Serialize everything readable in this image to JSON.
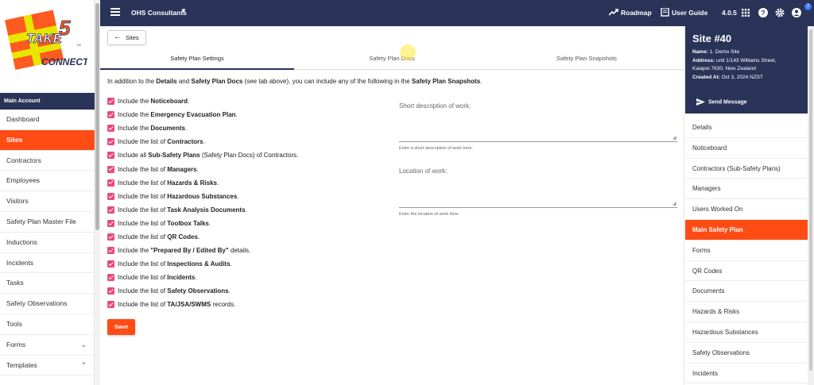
{
  "logo": {
    "line1": "TAKE",
    "num": "5",
    "line2": "CONNECT",
    "tm": "TM"
  },
  "sidebar": {
    "section": "Main Account",
    "items": [
      {
        "label": "Dashboard"
      },
      {
        "label": "Sites",
        "active": true
      },
      {
        "label": "Contractors"
      },
      {
        "label": "Employees"
      },
      {
        "label": "Visitors"
      },
      {
        "label": "Safety Plan Master File"
      },
      {
        "label": "Inductions"
      },
      {
        "label": "Incidents"
      },
      {
        "label": "Tasks"
      },
      {
        "label": "Safety Observations"
      },
      {
        "label": "Tools"
      },
      {
        "label": "Forms",
        "chevron": "⌄"
      },
      {
        "label": "Templates",
        "chevron": "⌃"
      }
    ]
  },
  "topbar": {
    "org": "OHS Consultants",
    "roadmap": "Roadmap",
    "user_guide": "User Guide",
    "version": "4.0.5",
    "notif_count": "2"
  },
  "content": {
    "back_label": "Sites",
    "tabs": [
      "Safety Plan Settings",
      "Safety Plan Docs",
      "Safety Plan Snapshots"
    ],
    "intro": {
      "p1": "In addition to the ",
      "b1": "Details",
      "p2": " and ",
      "b2": "Safety Plan Docs",
      "p3": " (see tab above), you can include any of the following in the ",
      "b3": "Safety Plan Snapshots",
      "p4": "."
    },
    "checks": [
      {
        "pre": "Include the ",
        "bold": "Noticeboard",
        "post": "."
      },
      {
        "pre": "Include the ",
        "bold": "Emergency Evacuation Plan",
        "post": "."
      },
      {
        "pre": "Include the ",
        "bold": "Documents",
        "post": "."
      },
      {
        "pre": "Include the list of ",
        "bold": "Contractors",
        "post": "."
      },
      {
        "pre": "Include all ",
        "bold": "Sub-Safety Plans",
        "post": " (Safety Plan Docs) of Contractors."
      },
      {
        "pre": "Include the list of ",
        "bold": "Managers",
        "post": "."
      },
      {
        "pre": "Include the list of ",
        "bold": "Hazards & Risks",
        "post": "."
      },
      {
        "pre": "Include the list of ",
        "bold": "Hazardous Substances",
        "post": "."
      },
      {
        "pre": "Include the list of ",
        "bold": "Task Analysis Documents",
        "post": "."
      },
      {
        "pre": "Include the list of ",
        "bold": "Toolbox Talks",
        "post": "."
      },
      {
        "pre": "Include the list of ",
        "bold": "QR Codes",
        "post": "."
      },
      {
        "pre": "Include the ",
        "bold": "\"Prepared By / Edited By\"",
        "post": " details."
      },
      {
        "pre": "Include the list of ",
        "bold": "Inspections & Audits",
        "post": "."
      },
      {
        "pre": "Include the list of ",
        "bold": "Incidents",
        "post": "."
      },
      {
        "pre": "Include the list of ",
        "bold": "Safety Observations",
        "post": "."
      },
      {
        "pre": "Include the list of ",
        "bold": "TA/JSA/SWMS",
        "post": " records."
      }
    ],
    "save_label": "Save",
    "short_desc": {
      "label": "Short description of work:",
      "help": "Enter a short description of work here."
    },
    "location": {
      "label": "Location of work:",
      "help": "Enter the location of work here."
    }
  },
  "site": {
    "title": "Site #40",
    "name_label": "Name:",
    "name": "1. Demo Site",
    "address_label": "Address:",
    "address1": "unit 1/143 Williams Street,",
    "address2": "Kaiapoi 7630, New Zealand",
    "created_label": "Created At:",
    "created": "Oct 3, 2024 NZST",
    "send_label": "Send Message"
  },
  "rnav": [
    {
      "label": "Details"
    },
    {
      "label": "Noticeboard"
    },
    {
      "label": "Contractors (Sub-Safety Plans)"
    },
    {
      "label": "Managers"
    },
    {
      "label": "Users Worked On"
    },
    {
      "label": "Main Safety Plan",
      "active": true
    },
    {
      "label": "Forms"
    },
    {
      "label": "QR Codes"
    },
    {
      "label": "Documents"
    },
    {
      "label": "Hazards & Risks"
    },
    {
      "label": "Hazardous Substances"
    },
    {
      "label": "Safety Observations"
    },
    {
      "label": "Incidents"
    }
  ],
  "colors": {
    "navy": "#2a3358",
    "accent": "#ff4c14",
    "check": "#e8497a"
  }
}
